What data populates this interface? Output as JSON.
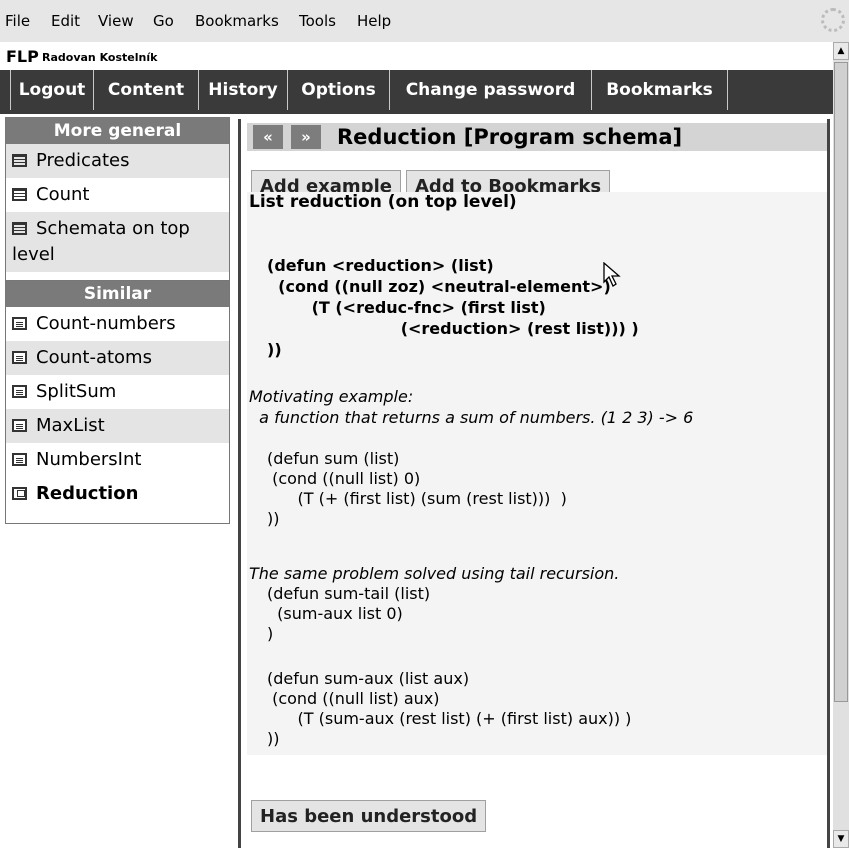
{
  "menubar": [
    "File",
    "Edit",
    "View",
    "Go",
    "Bookmarks",
    "Tools",
    "Help"
  ],
  "header": {
    "app": "FLP",
    "user": "Radovan Kostelník"
  },
  "nav": [
    "Logout",
    "Content",
    "History",
    "Options",
    "Change password",
    "Bookmarks"
  ],
  "more_general": {
    "title": "More general",
    "items": [
      "Predicates",
      "Count",
      "Schemata on top level"
    ]
  },
  "similar": {
    "title": "Similar",
    "items": [
      "Count-numbers",
      "Count-atoms",
      "SplitSum",
      "MaxList",
      "NumbersInt",
      "Reduction"
    ]
  },
  "main": {
    "prev": "«",
    "next": "»",
    "title": "Reduction [Program schema]",
    "add_example": "Add example",
    "add_bookmarks": "Add to Bookmarks",
    "heading": "List reduction (on top level)",
    "schema_lines": [
      "(defun <reduction> (list)",
      "  (cond ((null zoz) <neutral-element>)",
      "        (T (<reduc-fnc> (first list)",
      "                        (<reduction> (rest list))) )",
      "))"
    ],
    "motivating_label": "Motivating example:",
    "motivating_text": "  a function that returns a sum of numbers. (1 2 3) -> 6",
    "sum_lines": [
      "(defun sum (list)",
      " (cond ((null list) 0)",
      "      (T (+ (first list) (sum (rest list)))  )",
      "))"
    ],
    "tail_label": "The same problem solved using tail recursion.",
    "tail_lines": [
      "(defun sum-tail (list)",
      "  (sum-aux list 0)",
      ")"
    ],
    "aux_lines": [
      "(defun sum-aux (list aux)",
      " (cond ((null list) aux)",
      "      (T (sum-aux (rest list) (+ (first list) aux)) )",
      "))"
    ],
    "understood": "Has been understood"
  }
}
